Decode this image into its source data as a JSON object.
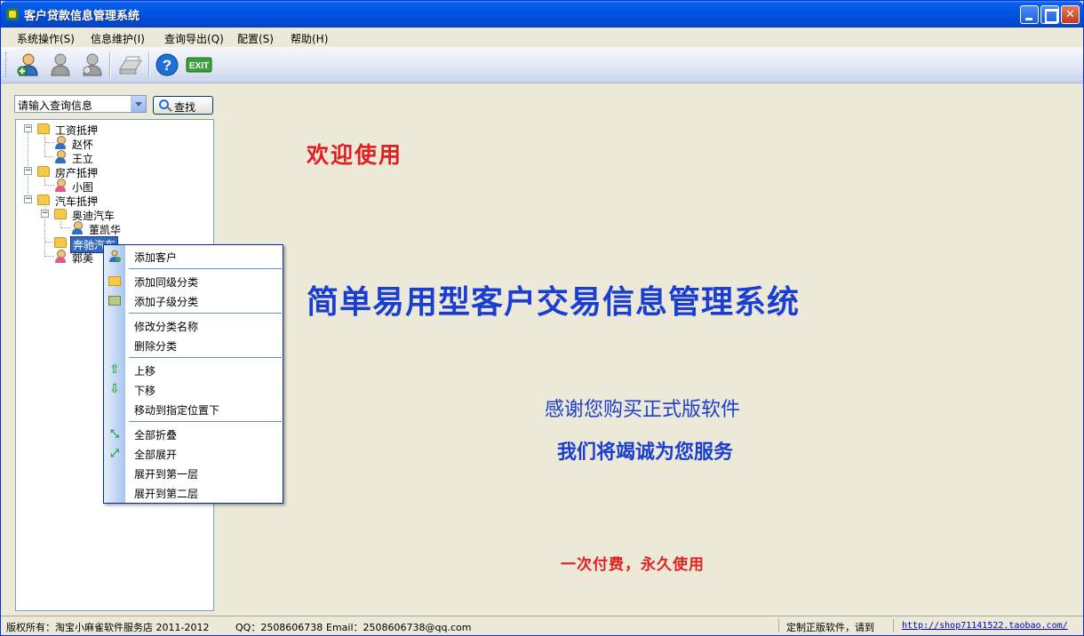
{
  "window": {
    "title": "客户贷款信息管理系统",
    "controls": {
      "minimize": "minimize",
      "maximize": "maximize",
      "close": "close"
    }
  },
  "menubar": {
    "items": [
      {
        "label": "系统操作(S)"
      },
      {
        "label": "信息维护(I)"
      },
      {
        "label": "查询导出(Q)"
      },
      {
        "label": "配置(S)"
      },
      {
        "label": "帮助(H)"
      }
    ]
  },
  "toolbar": {
    "buttons": [
      {
        "icon": "add-user-icon"
      },
      {
        "icon": "user-icon"
      },
      {
        "icon": "user-search-icon"
      },
      {
        "icon": "printer-icon"
      },
      {
        "icon": "help-icon"
      },
      {
        "icon": "exit-icon",
        "text": "EXIT"
      }
    ]
  },
  "search": {
    "selected": "请输入查询信息",
    "button_label": "查找"
  },
  "tree": {
    "nodes": [
      {
        "label": "工资抵押",
        "type": "folder",
        "expanded": true
      },
      {
        "label": "赵怀",
        "type": "person"
      },
      {
        "label": "王立",
        "type": "person"
      },
      {
        "label": "房产抵押",
        "type": "folder",
        "expanded": true
      },
      {
        "label": "小图",
        "type": "person-female"
      },
      {
        "label": "汽车抵押",
        "type": "folder",
        "expanded": true
      },
      {
        "label": "奥迪汽车",
        "type": "folder",
        "expanded": true
      },
      {
        "label": "董凯华",
        "type": "person"
      },
      {
        "label": "奔驰汽车",
        "type": "folder",
        "selected": true
      },
      {
        "label": "郭美",
        "type": "person-female"
      }
    ]
  },
  "context_menu": {
    "items": [
      {
        "label": "添加客户",
        "icon": "add-user-icon"
      },
      {
        "label": "添加同级分类",
        "icon": "folder-icon"
      },
      {
        "label": "添加子级分类",
        "icon": "subfolder-icon"
      },
      {
        "label": "修改分类名称"
      },
      {
        "label": "删除分类"
      },
      {
        "label": "上移",
        "icon": "arrow-up-icon"
      },
      {
        "label": "下移",
        "icon": "arrow-down-icon"
      },
      {
        "label": "移动到指定位置下"
      },
      {
        "label": "全部折叠",
        "icon": "collapse-all-icon"
      },
      {
        "label": "全部展开",
        "icon": "expand-all-icon"
      },
      {
        "label": "展开到第一层"
      },
      {
        "label": "展开到第二层"
      }
    ]
  },
  "main": {
    "welcome": "欢迎使用",
    "headline": "简单易用型客户交易信息管理系统",
    "thanks_line1": "感谢您购买正式版软件",
    "thanks_line2": "我们将竭诚为您服务",
    "slogan": "一次付费，永久使用"
  },
  "statusbar": {
    "copyright": "版权所有：淘宝小麻雀软件服务店 2011-2012",
    "qq": "QQ：2508606738",
    "email": "Email：2508606738@qq.com",
    "custom": "定制正版软件，请到",
    "link": "http://shop71141522.taobao.com/"
  },
  "colors": {
    "title_bar": "#0055e5",
    "welcome_red": "#e02020",
    "headline_blue": "#1a3fd0",
    "selection": "#316ac5"
  }
}
